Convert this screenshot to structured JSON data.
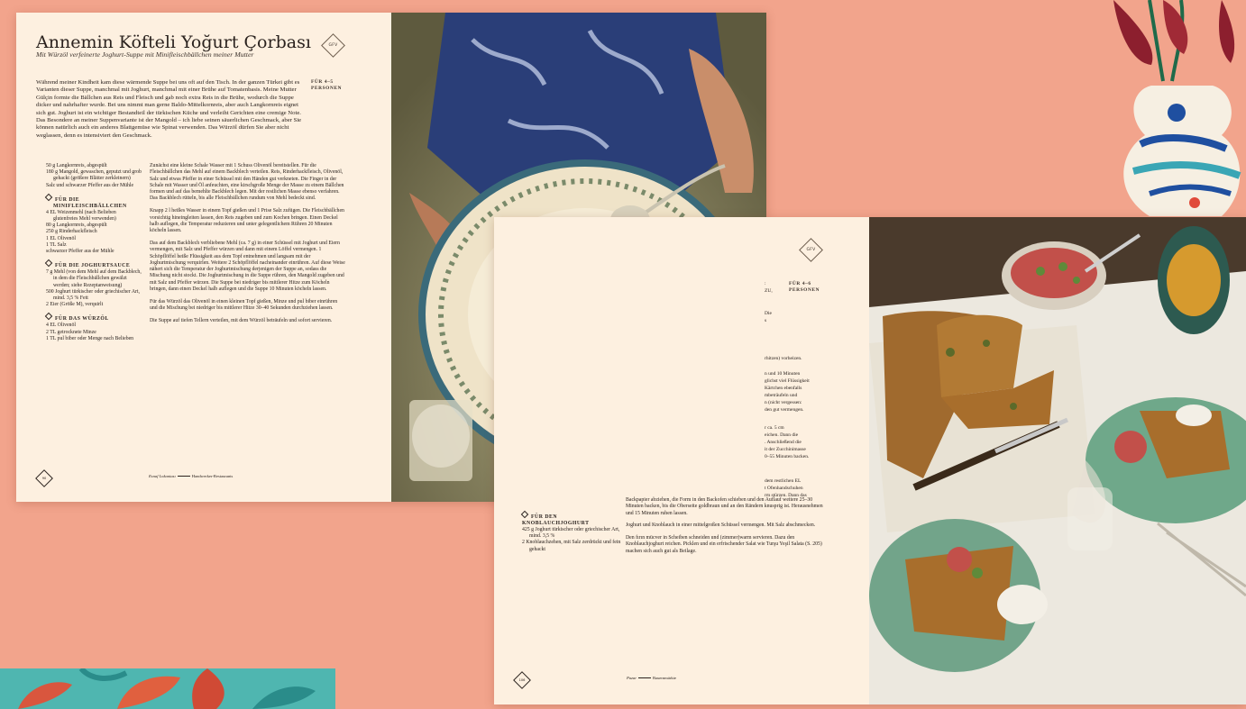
{
  "recipe_left": {
    "title": "Annemin Köfteli Yoğurt Çorbası",
    "subtitle": "Mit Würzöl verfeinerte Joghurt-Suppe mit Minifleischbällchen meiner Mutter",
    "badge": "GFV",
    "serves": [
      "FÜR 4–5",
      "PERSONEN"
    ],
    "intro": "Während meiner Kindheit kam diese wärmende Suppe bei uns oft auf den Tisch. In der ganzen Türkei gibt es Varianten dieser Suppe, manchmal mit Joghurt, manchmal mit einer Brühe auf Tomatenbasis. Meine Mutter Gülçin formte die Bällchen aus Reis und Fleisch und gab noch extra Reis in die Brühe, wodurch die Suppe dicker und nahrhafter wurde. Bei uns nimmt man gerne Baldo-Mittelkornreis, aber auch Langkornreis eignet sich gut. Joghurt ist ein wichtiger Bestandteil der türkischen Küche und verleiht Gerichten eine cremige Note. Das Besondere an meiner Suppenvariante ist der Mangold – ich liebe seinen säuerlichen Geschmack, aber Sie können natürlich auch ein anderes Blattgemüse wie Spinat verwenden. Das Würzöl dürfen Sie aber nicht weglassen, denn es intensiviert den Geschmack.",
    "ingredients_main": [
      "50 g Langkornreis, abgespült",
      "180 g Mangold, gewaschen, geputzt und grob gehackt (größere Blätter zerkleinern)",
      "Salz und schwarzer Pfeffer aus der Mühle"
    ],
    "groups": [
      {
        "heading": [
          "FÜR DIE",
          "MINIFLEISCHBÄLLCHEN"
        ],
        "items": [
          "4 EL Weizenmehl (nach Belieben glutenfreies Mehl verwenden)",
          "80 g Langkornreis, abgespült",
          "250 g Rinderhackfleisch",
          "1 EL Olivenöl",
          "1 TL Salz",
          "schwarzer Pfeffer aus der Mühle"
        ]
      },
      {
        "heading": [
          "FÜR DIE JOGHURTSAUCE"
        ],
        "items": [
          "7 g Mehl (von dem Mehl auf dem Backblech, in dem die Fleischbällchen gewälzt werden; siehe Rezeptanweisung)",
          "500 Joghurt türkischer oder griechischer Art, mind. 3,5 % Fett",
          "2 Eier (Größe M), verquirlt"
        ]
      },
      {
        "heading": [
          "FÜR DAS WÜRZÖL"
        ],
        "items": [
          "4 EL Olivenöl",
          "2 TL getrocknete Minze",
          "1 TL pul biber oder Menge nach Belieben"
        ]
      }
    ],
    "steps": [
      "Zunächst eine kleine Schale Wasser mit 1 Schuss Olivenöl bereitstellen. Für die Fleischbällchen das Mehl auf einem Backblech verteilen. Reis, Rinderhackfleisch, Olivenöl, Salz und etwas Pfeffer in einer Schüssel mit den Händen gut verkneten. Die Finger in der Schale mit Wasser und Öl anfeuchten, eine kirschgroße Menge der Masse zu einem Bällchen formen und auf das bemehlte Backblech legen. Mit der restlichen Masse ebenso verfahren. Das Backblech rütteln, bis alle Fleischbällchen rundum von Mehl bedeckt sind.",
      "Knapp 2 l heißes Wasser in einem Topf gießen und 1 Prise Salz zufügen. Die Fleischbällchen vorsichtig hineingleiten lassen, den Reis zugeben und zum Kochen bringen. Einen Deckel halb auflegen, die Temperatur reduzieren und unter gelegentlichem Rühren 20 Minuten köcheln lassen.",
      "Das auf dem Backblech verbliebene Mehl (ca. 7 g) in einer Schüssel mit Joghurt und Eiern vermengen, mit Salz und Pfeffer würzen und dann mit einem Löffel vermengen. 1 Schöpflöffel heiße Flüssigkeit aus dem Topf entnehmen und langsam mit der Joghurtmischung verquirlen. Weitere 2 Schöpflöffel nacheinander einrühren. Auf diese Weise nähert sich die Temperatur der Joghurtmischung derjenigen der Suppe an, sodass die Mischung nicht stockt. Die Joghurtmischung in die Suppe rühren, den Mangold zugeben und mit Salz und Pfeffer würzen. Die Suppe bei niedriger bis mittlerer Hitze zum Köcheln bringen, dann einen Deckel halb auflegen und die Suppe 10 Minuten köcheln lassen.",
      "Für das Würzöl das Olivenöl in einen kleinen Topf gießen, Minze und pul biber einrühren und die Mischung bei niedriger bis mittlerer Hitze 30–40 Sekunden durchziehen lassen.",
      "Die Suppe auf tiefen Tellern verteilen, mit dem Würzöl beträufeln und sofort servieren."
    ],
    "page_number": "90",
    "footer_left": "Esnaf Lokantası",
    "footer_right": "Handwerker-Restaurants"
  },
  "recipe_right": {
    "badge": "GFV",
    "serves": [
      "FÜR 4–6",
      "PERSONEN"
    ],
    "top_fragments": [
      ":",
      "ZU,",
      "Die",
      "s"
    ],
    "fragments": [
      "rhitzen) vorheizen.",
      "n und 10 Minuten",
      "glichst viel Flüssigkeit",
      "Kärtchen ebenfalls",
      "mbeträufeln und",
      "n (nicht vergessen:",
      "den gut vermengen.",
      "r ca. 5 cm",
      "eichen. Dann die",
      ". Anschließend die",
      "it der Zucchinimasse",
      "0–55 Minuten backen.",
      "dem restlichen EL",
      "t Ofenhandschuhen",
      "rm stürzen. Dann das"
    ],
    "group_heading": [
      "FÜR DEN",
      "KNOBLAUCHJOGHURT"
    ],
    "group_items": [
      "425 g Joghurt türkischer oder griechischer Art, mind. 3,5 %",
      "2 Knoblauchzehen, mit Salz zerdrückt und fein gehackt"
    ],
    "steps": [
      "Backpapier abziehen, die Form in den Backofen schieben und den Auflauf weitere 25–30 Minuten backen, bis die Oberseite goldbraun und an den Rändern knusprig ist. Herausnehmen und 15 Minuten ruhen lassen.",
      "Joghurt und Knoblauch in einer mittelgroßen Schüssel vermengen. Mit Salz abschmecken.",
      "Den fırın mücver in Scheiben schneiden und (zimmer)warm servieren. Dazu den Knoblauchjoghurt reichen. Picklen und ein erfrischender Salat wie Turşu Yeşil Salata (S. 205) machen sich auch gut als Beilage."
    ],
    "page_number": "106",
    "footer_left": "Pazar",
    "footer_right": "Bauernmärkte"
  },
  "colors": {
    "background": "#f2a48c",
    "page": "#fdf0e0",
    "text": "#2a221e"
  }
}
